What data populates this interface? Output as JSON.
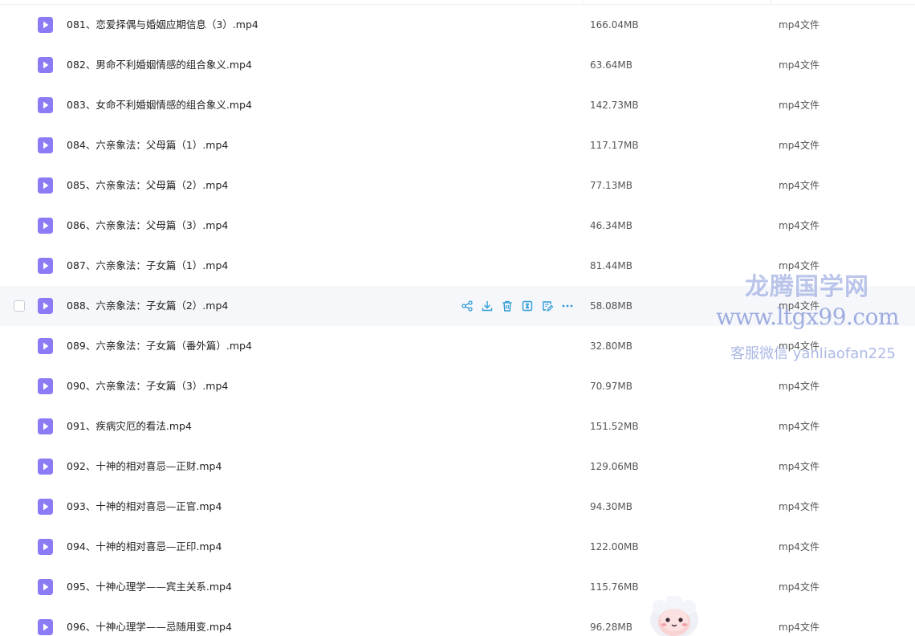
{
  "colors": {
    "video_icon": "#8b7cf6",
    "action_icon": "#2f9bd6",
    "hover_row": "#f6f7fb"
  },
  "icons": {
    "file": "video-file-icon",
    "actions": [
      "share-icon",
      "download-icon",
      "delete-icon",
      "compress-icon",
      "edit-icon",
      "more-icon"
    ]
  },
  "files": [
    {
      "name": "081、恋爱择偶与婚姻应期信息（3）.mp4",
      "size": "166.04MB",
      "type": "mp4文件"
    },
    {
      "name": "082、男命不利婚姻情感的组合象义.mp4",
      "size": "63.64MB",
      "type": "mp4文件"
    },
    {
      "name": "083、女命不利婚姻情感的组合象义.mp4",
      "size": "142.73MB",
      "type": "mp4文件"
    },
    {
      "name": "084、六亲象法：父母篇（1）.mp4",
      "size": "117.17MB",
      "type": "mp4文件"
    },
    {
      "name": "085、六亲象法：父母篇（2）.mp4",
      "size": "77.13MB",
      "type": "mp4文件"
    },
    {
      "name": "086、六亲象法：父母篇（3）.mp4",
      "size": "46.34MB",
      "type": "mp4文件"
    },
    {
      "name": "087、六亲象法：子女篇（1）.mp4",
      "size": "81.44MB",
      "type": "mp4文件"
    },
    {
      "name": "088、六亲象法：子女篇（2）.mp4",
      "size": "58.08MB",
      "type": "mp4文件",
      "hover": true
    },
    {
      "name": "089、六亲象法：子女篇（番外篇）.mp4",
      "size": "32.80MB",
      "type": "mp4文件"
    },
    {
      "name": "090、六亲象法：子女篇（3）.mp4",
      "size": "70.97MB",
      "type": "mp4文件"
    },
    {
      "name": "091、疾病灾厄的看法.mp4",
      "size": "151.52MB",
      "type": "mp4文件"
    },
    {
      "name": "092、十神的相对喜忌—正财.mp4",
      "size": "129.06MB",
      "type": "mp4文件"
    },
    {
      "name": "093、十神的相对喜忌—正官.mp4",
      "size": "94.30MB",
      "type": "mp4文件"
    },
    {
      "name": "094、十神的相对喜忌—正印.mp4",
      "size": "122.00MB",
      "type": "mp4文件"
    },
    {
      "name": "095、十神心理学——宾主关系.mp4",
      "size": "115.76MB",
      "type": "mp4文件"
    },
    {
      "name": "096、十神心理学——忌随用变.mp4",
      "size": "96.28MB",
      "type": "mp4文件"
    }
  ],
  "watermark": {
    "line1": "龙腾国学网",
    "line2": "www.ltgx99.com",
    "line3": "客服微信 yanliaofan225"
  }
}
